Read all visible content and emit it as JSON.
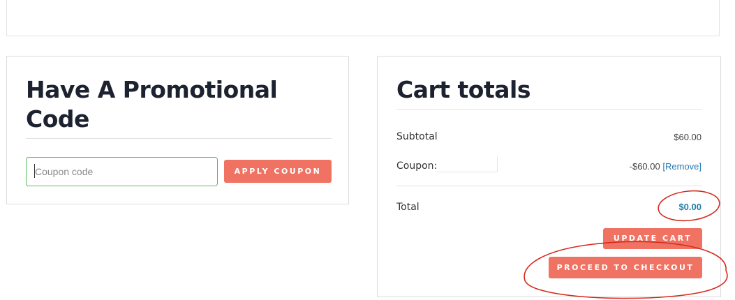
{
  "promo": {
    "heading": "Have A Promotional Code",
    "coupon_placeholder": "Coupon code",
    "apply_button": "APPLY COUPON"
  },
  "totals": {
    "heading": "Cart totals",
    "subtotal_label": "Subtotal",
    "subtotal_value": "$60.00",
    "coupon_label": "Coupon:",
    "coupon_value": "-$60.00",
    "remove_link": "[Remove]",
    "total_label": "Total",
    "total_value": "$0.00",
    "update_button": "UPDATE CART",
    "checkout_button": "PROCEED TO CHECKOUT"
  },
  "colors": {
    "button": "#f07262",
    "input_border_active": "#5cb85c",
    "total_value": "#1f7fa8",
    "annotation": "#d62a1e"
  }
}
